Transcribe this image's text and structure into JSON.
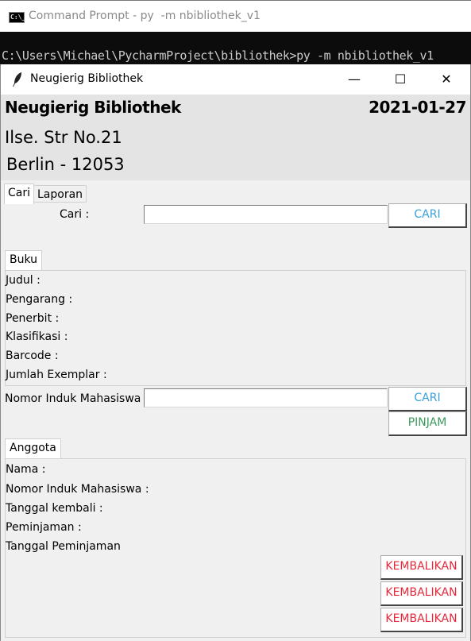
{
  "cmd": {
    "title": "Command Prompt - py  -m nbibliothek_v1",
    "icon_text": "C:\\_",
    "prompt_line": "C:\\Users\\Michael\\PycharmProject\\bibliothek>py -m nbibliothek_v1"
  },
  "window": {
    "title": "Neugierig Bibliothek",
    "minimize": "—",
    "maximize": "☐",
    "close": "✕"
  },
  "header": {
    "name": "Neugierig Bibliothek",
    "date": "2021-01-27",
    "address_line1": "Ilse. Str No.21",
    "address_line2": "Berlin - 12053"
  },
  "tabs": [
    {
      "label": "Cari",
      "active": true
    },
    {
      "label": "Laporan",
      "active": false
    }
  ],
  "search": {
    "label": "Cari :",
    "value": "",
    "button": "CARI"
  },
  "buku": {
    "tab": "Buku",
    "fields": [
      "Judul :",
      "Pengarang :",
      "Penerbit :",
      "Klasifikasi :",
      "Barcode :",
      "Jumlah Exemplar :"
    ]
  },
  "nim": {
    "label": "Nomor Induk Mahasiswa :",
    "value": "",
    "search_button": "CARI",
    "borrow_button": "PINJAM"
  },
  "anggota": {
    "tab": "Anggota",
    "fields": [
      "Nama :",
      "Nomor Induk Mahasiswa :",
      "Tanggal kembali :",
      "Peminjaman :",
      "Tanggal Peminjaman"
    ],
    "return_buttons": [
      "KEMBALIKAN",
      "KEMBALIKAN",
      "KEMBALIKAN"
    ]
  },
  "colors": {
    "accent_blue": "#3aa0d8",
    "accent_green": "#3a9a5a",
    "accent_red": "#e8283a"
  }
}
